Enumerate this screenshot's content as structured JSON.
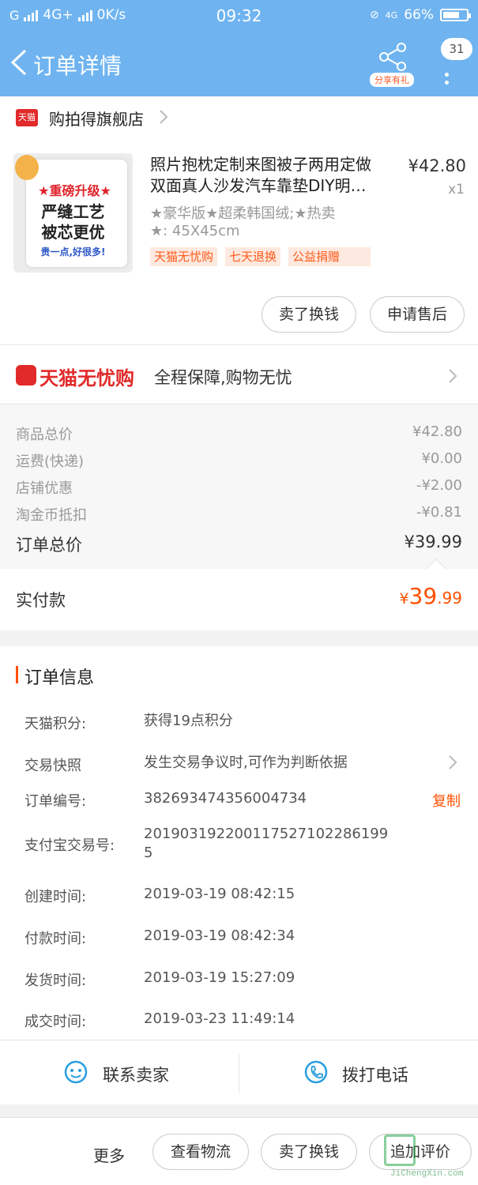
{
  "status_bar": {
    "network": "4G+",
    "speed": "0K/s",
    "time": "09:32",
    "net2": "4G",
    "battery": "66%"
  },
  "header": {
    "title": "订单详情",
    "share_label": "分享有礼",
    "badge_count": "31"
  },
  "store": {
    "logo_text": "天猫",
    "name": "购拍得旗舰店"
  },
  "product": {
    "image_lines": [
      "★重磅升级★",
      "严缝工艺",
      "被芯更优",
      "贵一点,好很多!"
    ],
    "title_line1": "照片抱枕定制来图被子两用定做",
    "title_line2": "双面真人沙发汽车靠垫DIY明…",
    "price": "¥42.80",
    "quantity": "x1",
    "sku_line1": "★豪华版★超柔韩国绒;★热卖",
    "sku_line2": "★: 45X45cm",
    "tags": [
      "天猫无忧购",
      "七天退换",
      "公益捐赠"
    ]
  },
  "actions": {
    "sell_label": "卖了换钱",
    "after_sale_label": "申请售后"
  },
  "guarantee": {
    "brand": "天猫无忧购",
    "text": "全程保障,购物无忧"
  },
  "cost": {
    "rows": [
      {
        "label": "商品总价",
        "value": "¥42.80"
      },
      {
        "label": "运费(快递)",
        "value": "¥0.00"
      },
      {
        "label": "店铺优惠",
        "value": "-¥2.00"
      },
      {
        "label": "淘金币抵扣",
        "value": "-¥0.81"
      }
    ],
    "total_label": "订单总价",
    "total_value": "¥39.99",
    "paid_label": "实付款",
    "paid_currency": "¥",
    "paid_int": "39",
    "paid_dec": ".99"
  },
  "order_info": {
    "title": "订单信息",
    "rows": [
      {
        "label": "天猫积分:",
        "value": "获得19点积分"
      },
      {
        "label": "交易快照",
        "value": "发生交易争议时,可作为判断依据"
      },
      {
        "label": "订单编号:",
        "value": "382693474356004734"
      },
      {
        "label": "支付宝交易号:",
        "value": "2019031922001175271022861995"
      },
      {
        "label": "创建时间:",
        "value": "2019-03-19 08:42:15"
      },
      {
        "label": "付款时间:",
        "value": "2019-03-19 08:42:34"
      },
      {
        "label": "发货时间:",
        "value": "2019-03-19 15:27:09"
      },
      {
        "label": "成交时间:",
        "value": "2019-03-23 11:49:14"
      }
    ],
    "copy_label": "复制"
  },
  "contact": {
    "seller_label": "联系卖家",
    "phone_label": "拨打电话"
  },
  "bottom_bar": {
    "more_label": "更多",
    "logistics_label": "查看物流",
    "sell_label": "卖了换钱",
    "review_label": "追加评价"
  },
  "watermark": {
    "url": "JiChengXin.com"
  },
  "colors": {
    "header_bg": "#6fb4f0",
    "accent": "#ff5000",
    "tmall_red": "#e22a2a"
  }
}
